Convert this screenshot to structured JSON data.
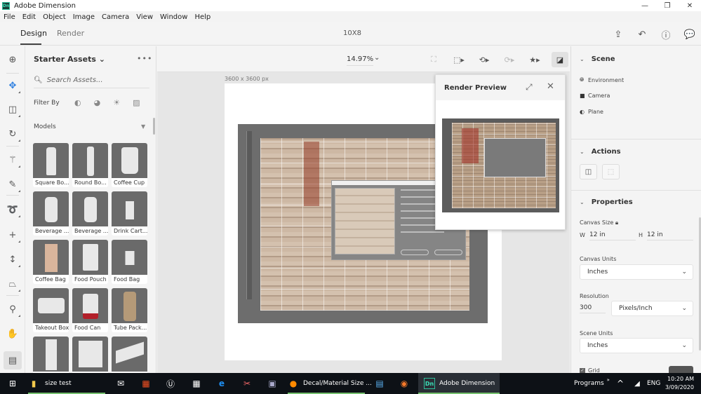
{
  "app": {
    "title": "Adobe Dimension",
    "logo_text": "Dn",
    "window_controls": {
      "minimize": "—",
      "restore": "❐",
      "close": "✕"
    }
  },
  "menu": [
    "File",
    "Edit",
    "Object",
    "Image",
    "Camera",
    "View",
    "Window",
    "Help"
  ],
  "modes": {
    "design": "Design",
    "render": "Render",
    "active": "Design"
  },
  "document_title": "10X8",
  "top_icons": [
    "share-icon",
    "undo-icon",
    "help-icon",
    "feedback-icon"
  ],
  "tools": [
    {
      "name": "add-content-icon",
      "glyph": "⊕"
    },
    {
      "name": "select-move-icon",
      "glyph": "✥",
      "active": true
    },
    {
      "name": "rectangle-select-icon",
      "glyph": "◫"
    },
    {
      "name": "orbit-icon",
      "glyph": "↻"
    },
    {
      "name": "magic-wand-icon",
      "glyph": "⚚"
    },
    {
      "name": "eyedropper-icon",
      "glyph": "✎"
    },
    {
      "name": "lasso-icon",
      "glyph": "➰"
    },
    {
      "name": "pan-move-icon",
      "glyph": "+"
    },
    {
      "name": "dolly-icon",
      "glyph": "↕"
    },
    {
      "name": "perspective-icon",
      "glyph": "⏢"
    },
    {
      "name": "zoom-icon",
      "glyph": "⚲"
    },
    {
      "name": "hand-icon",
      "glyph": "✋"
    },
    {
      "name": "assets-panel-icon",
      "glyph": "▤",
      "selected": true
    }
  ],
  "assets": {
    "header": "Starter Assets",
    "header_chevron": "⌄",
    "more": "•••",
    "search_placeholder": "Search Assets...",
    "filter_label": "Filter By",
    "filter_icons": [
      "model-filter-icon",
      "material-filter-icon",
      "light-filter-icon",
      "image-filter-icon"
    ],
    "section": "Models",
    "items": [
      {
        "label": "Square Bo..."
      },
      {
        "label": "Round Bo..."
      },
      {
        "label": "Coffee Cup"
      },
      {
        "label": "Beverage ..."
      },
      {
        "label": "Beverage ..."
      },
      {
        "label": "Drink Cart..."
      },
      {
        "label": "Coffee Bag"
      },
      {
        "label": "Food Pouch"
      },
      {
        "label": "Food Bag"
      },
      {
        "label": "Takeout Box"
      },
      {
        "label": "Food Can"
      },
      {
        "label": "Tube Pack..."
      },
      {
        "label": ""
      },
      {
        "label": ""
      },
      {
        "label": ""
      }
    ]
  },
  "viewport": {
    "zoom": "14.97%",
    "canvas_size_label": "3600 x 3600 px",
    "toolbar_icons": [
      "frame-icon",
      "camera-bookmark-icon",
      "camera-undo-icon",
      "camera-redo-icon",
      "camera-favorite-icon",
      "render-preview-icon"
    ]
  },
  "render_preview": {
    "title": "Render Preview",
    "expand": "⤢",
    "close": "✕"
  },
  "properties_panel": {
    "scene": {
      "title": "Scene",
      "items": [
        {
          "label": "Environment",
          "icon": "environment-icon"
        },
        {
          "label": "Camera",
          "icon": "camera-icon"
        },
        {
          "label": "Plane",
          "icon": "plane-icon"
        }
      ]
    },
    "actions": {
      "title": "Actions"
    },
    "properties": {
      "title": "Properties",
      "canvas_size_label": "Canvas Size",
      "width_prefix": "W",
      "width": "12 in",
      "height_prefix": "H",
      "height": "12 in",
      "canvas_units_label": "Canvas Units",
      "canvas_units": "Inches",
      "resolution_label": "Resolution",
      "resolution": "300",
      "resolution_unit": "Pixels/Inch",
      "scene_units_label": "Scene Units",
      "scene_units": "Inches",
      "grid_label": "Grid",
      "grid_checked": true
    }
  },
  "taskbar": {
    "start": "windows-start-icon",
    "items": [
      {
        "label": "size test",
        "icon": "folder-icon"
      },
      {
        "label": "",
        "icon": "mail-icon"
      },
      {
        "label": "",
        "icon": "store-icon"
      },
      {
        "label": "",
        "icon": "unreal-engine-icon"
      },
      {
        "label": "",
        "icon": "calendar-icon"
      },
      {
        "label": "",
        "icon": "edge-icon"
      },
      {
        "label": "",
        "icon": "snipping-tool-icon"
      },
      {
        "label": "",
        "icon": "photos-icon"
      },
      {
        "label": "Decal/Material Size ...",
        "icon": "firefox-icon"
      },
      {
        "label": "",
        "icon": "control-panel-icon"
      },
      {
        "label": "",
        "icon": "blender-icon"
      },
      {
        "label": "Adobe Dimension",
        "icon": "dimension-icon"
      }
    ],
    "programs": "Programs",
    "language": "ENG",
    "time": "10:20 AM",
    "date": "3/09/2020"
  },
  "colors": {
    "accent_blue": "#2d7fe0",
    "dimension_green": "#2dbf9b",
    "taskbar": "#0d1116"
  }
}
